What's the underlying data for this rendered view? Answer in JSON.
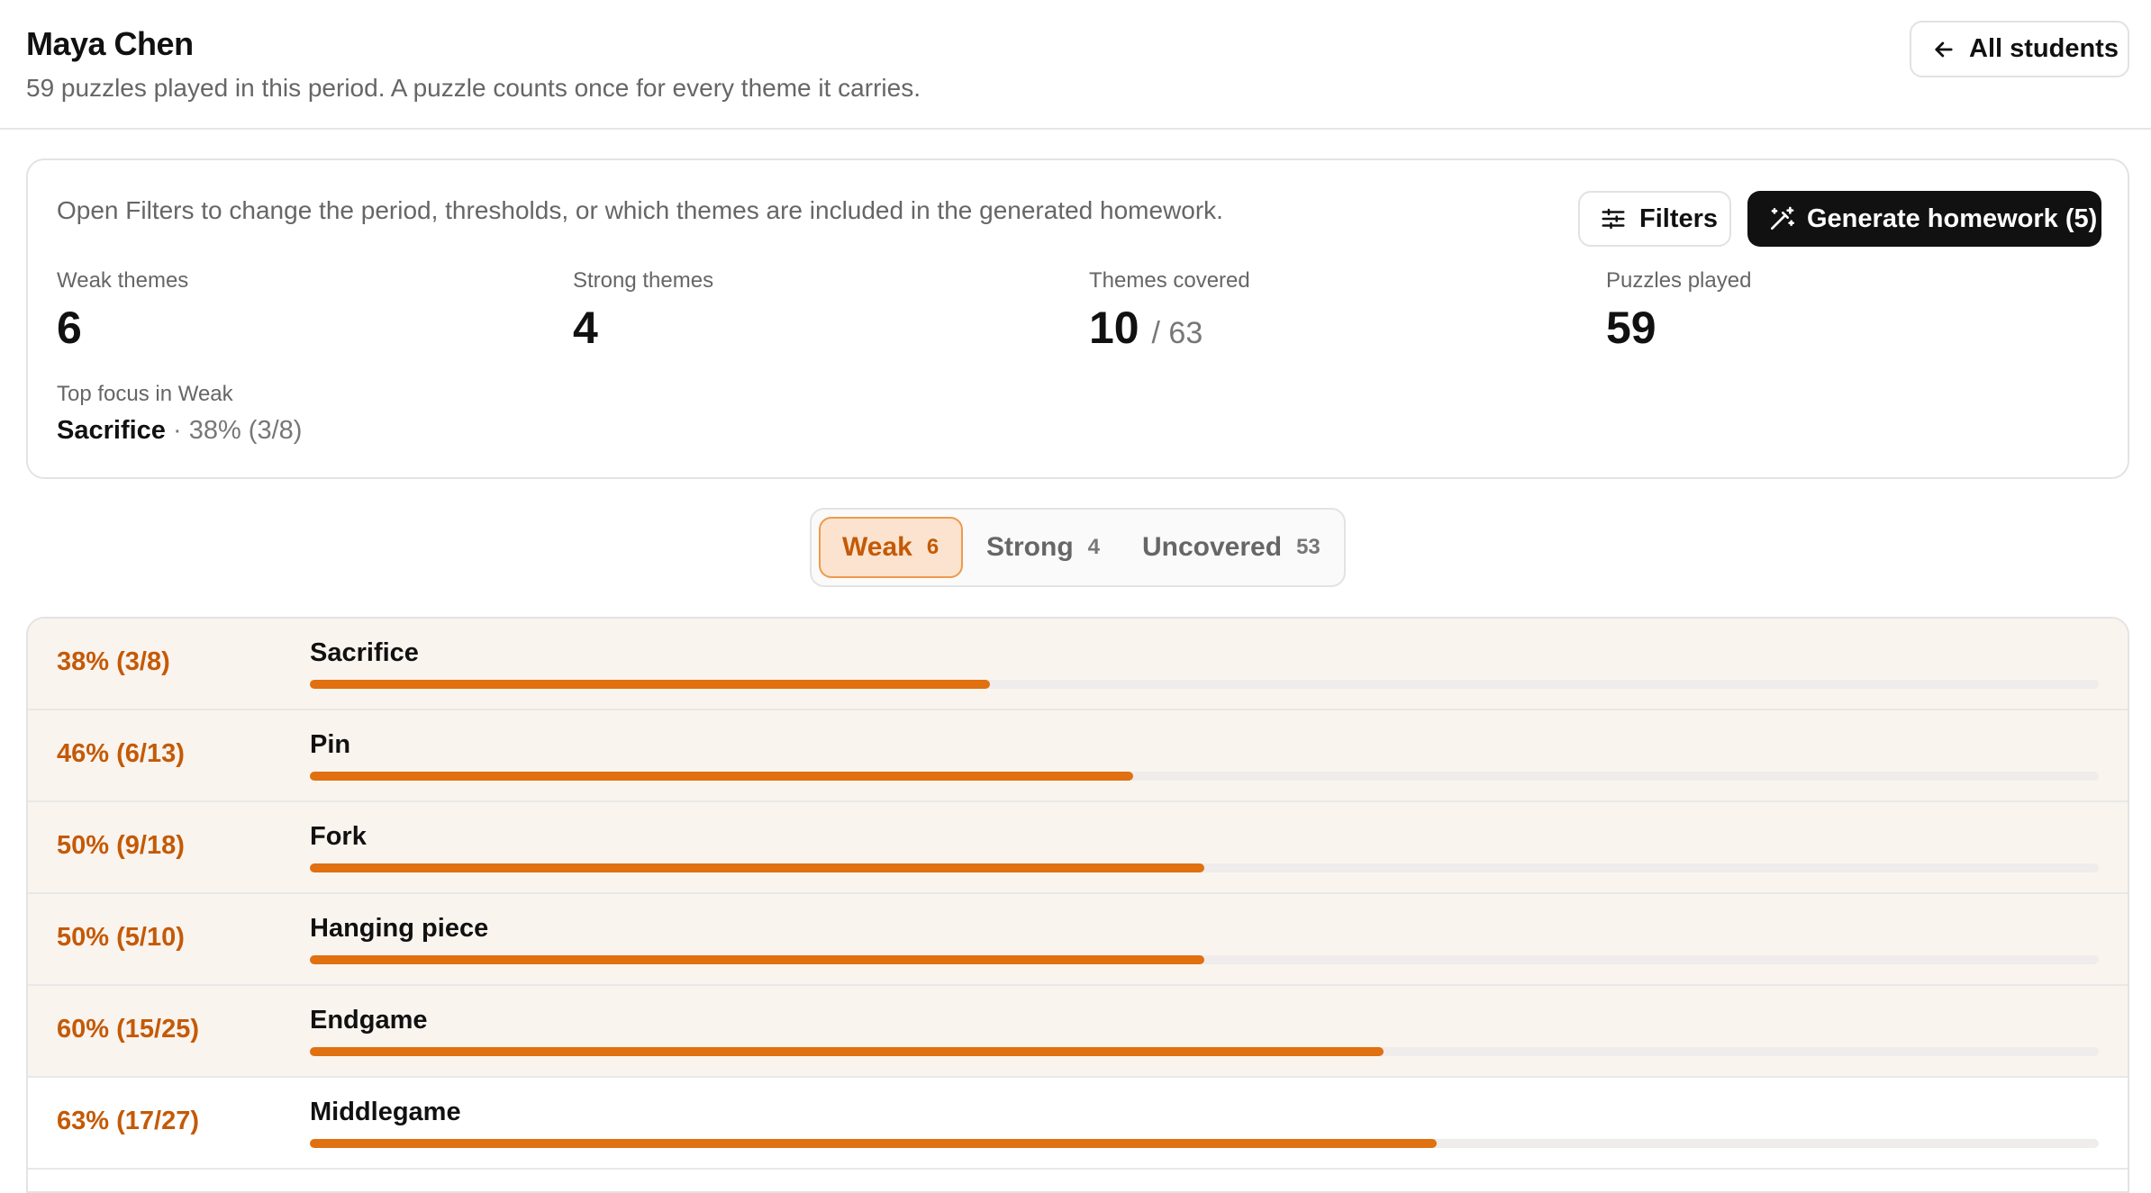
{
  "header": {
    "student_name": "Maya Chen",
    "subtitle": "59 puzzles played in this period. A puzzle counts once for every theme it carries.",
    "back_label": "All students"
  },
  "panel": {
    "hint": "Open Filters to change the period, thresholds, or which themes are included in the generated homework.",
    "filters_label": "Filters",
    "generate_label": "Generate homework (5)",
    "stats": [
      {
        "label": "Weak themes",
        "value": "6"
      },
      {
        "label": "Strong themes",
        "value": "4"
      },
      {
        "label": "Themes covered",
        "value": "10",
        "of": "/ 63"
      },
      {
        "label": "Puzzles played",
        "value": "59"
      }
    ],
    "focus_label": "Top focus in Weak",
    "focus_theme": "Sacrifice",
    "focus_detail": "· 38% (3/8)"
  },
  "tabs": [
    {
      "label": "Weak",
      "count": "6"
    },
    {
      "label": "Strong",
      "count": "4"
    },
    {
      "label": "Uncovered",
      "count": "53"
    }
  ],
  "rows": [
    {
      "rate": "38% (3/8)",
      "theme": "Sacrifice",
      "fraction": 0.38,
      "weak": true
    },
    {
      "rate": "46% (6/13)",
      "theme": "Pin",
      "fraction": 0.46,
      "weak": true
    },
    {
      "rate": "50% (9/18)",
      "theme": "Fork",
      "fraction": 0.5,
      "weak": true
    },
    {
      "rate": "50% (5/10)",
      "theme": "Hanging piece",
      "fraction": 0.5,
      "weak": true
    },
    {
      "rate": "60% (15/25)",
      "theme": "Endgame",
      "fraction": 0.6,
      "weak": true
    },
    {
      "rate": "63% (17/27)",
      "theme": "Middlegame",
      "fraction": 0.63,
      "weak": false
    }
  ],
  "colors": {
    "accent": "#e07010",
    "accent_text": "#c45a06",
    "weak_row_bg": "#faf4ef",
    "active_tab_bg": "#fbe3cf"
  }
}
